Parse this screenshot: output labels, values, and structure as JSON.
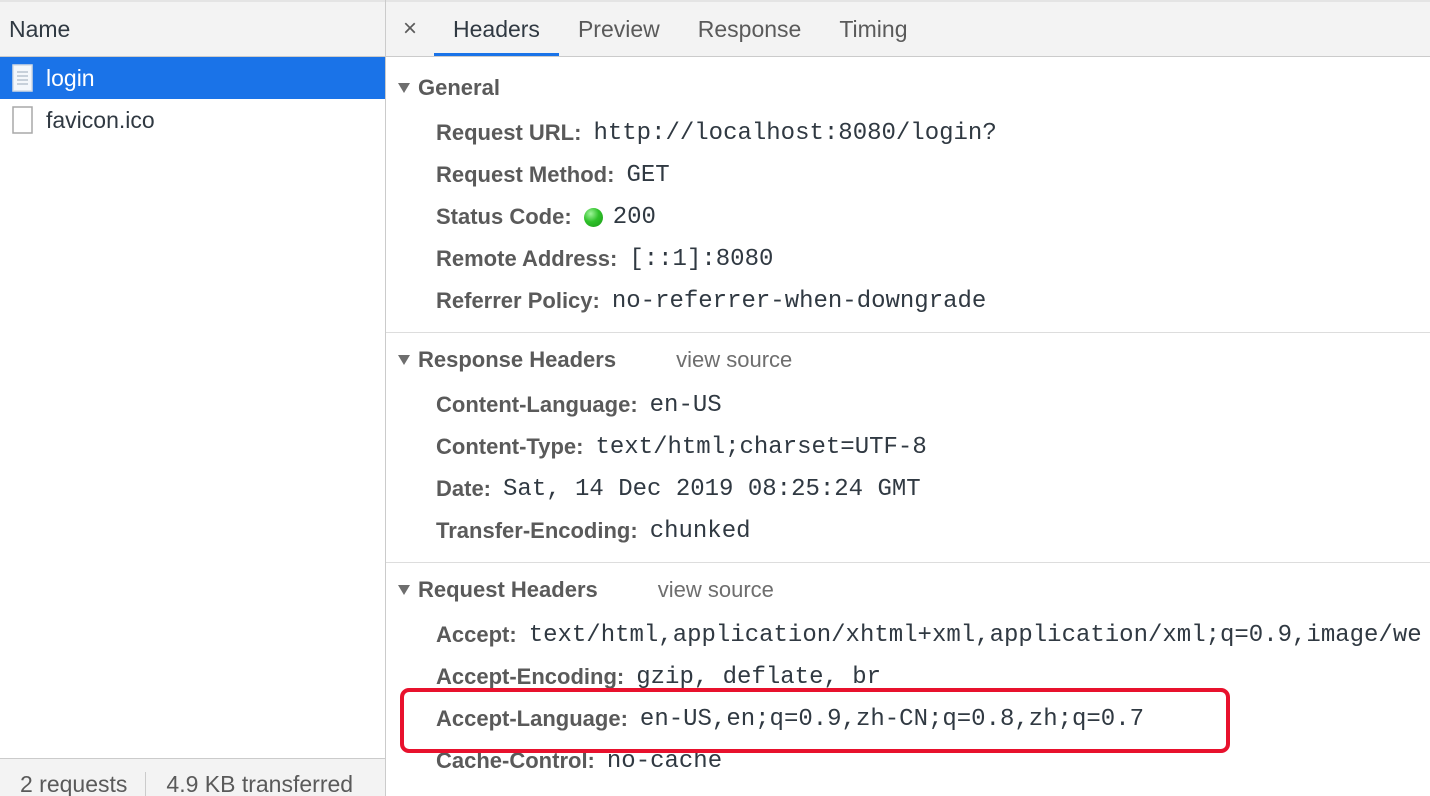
{
  "name_panel": {
    "header": "Name",
    "requests": [
      {
        "name": "login",
        "selected": true
      },
      {
        "name": "favicon.ico",
        "selected": false
      }
    ],
    "status": {
      "requests": "2 requests",
      "transferred": "4.9 KB transferred"
    }
  },
  "tabs": {
    "close": "×",
    "items": [
      "Headers",
      "Preview",
      "Response",
      "Timing"
    ],
    "active": "Headers"
  },
  "general": {
    "title": "General",
    "request_url_key": "Request URL:",
    "request_url": "http://localhost:8080/login?",
    "request_method_key": "Request Method:",
    "request_method": "GET",
    "status_code_key": "Status Code:",
    "status_code": "200",
    "remote_address_key": "Remote Address:",
    "remote_address": "[::1]:8080",
    "referrer_policy_key": "Referrer Policy:",
    "referrer_policy": "no-referrer-when-downgrade"
  },
  "response_headers": {
    "title": "Response Headers",
    "view_source": "view source",
    "rows": [
      {
        "key": "Content-Language:",
        "value": "en-US"
      },
      {
        "key": "Content-Type:",
        "value": "text/html;charset=UTF-8"
      },
      {
        "key": "Date:",
        "value": "Sat, 14 Dec 2019 08:25:24 GMT"
      },
      {
        "key": "Transfer-Encoding:",
        "value": "chunked"
      }
    ]
  },
  "request_headers": {
    "title": "Request Headers",
    "view_source": "view source",
    "rows": [
      {
        "key": "Accept:",
        "value": "text/html,application/xhtml+xml,application/xml;q=0.9,image/we"
      },
      {
        "key": "Accept-Encoding:",
        "value": "gzip, deflate, br"
      },
      {
        "key": "Accept-Language:",
        "value": "en-US,en;q=0.9,zh-CN;q=0.8,zh;q=0.7"
      },
      {
        "key": "Cache-Control:",
        "value": "no-cache"
      }
    ]
  },
  "colors": {
    "selected_row": "#1a73e8",
    "active_tab_underline": "#1a73e8",
    "highlight_box": "#e8112d",
    "status_ok": "#2fc12a"
  }
}
